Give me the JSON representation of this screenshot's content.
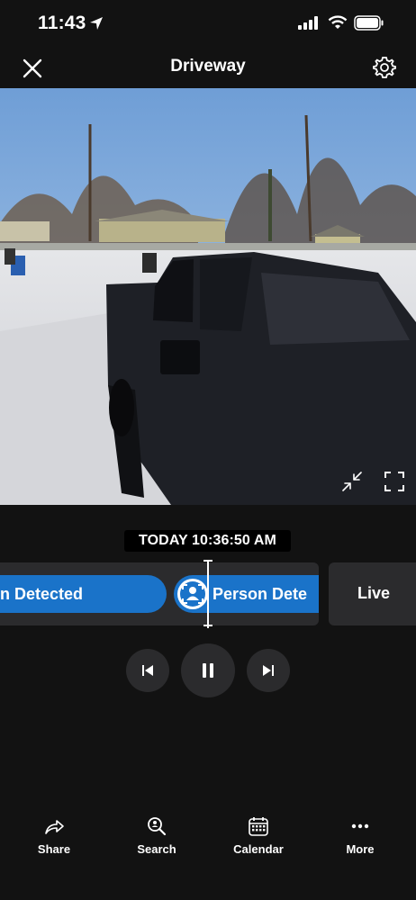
{
  "status_bar": {
    "time": "11:43"
  },
  "header": {
    "title": "Driveway"
  },
  "video": {
    "timestamp": "TODAY 10:36:50 AM"
  },
  "timeline": {
    "events": [
      {
        "label": "n Detected"
      },
      {
        "label": "Person Dete"
      }
    ],
    "live_label": "Live"
  },
  "bottom_nav": {
    "share": "Share",
    "search": "Search",
    "calendar": "Calendar",
    "more": "More"
  },
  "colors": {
    "accent": "#1a73c9",
    "background": "#121212",
    "surface": "#2b2b2d"
  },
  "icons": [
    "location-arrow-icon",
    "cellular-signal-icon",
    "wifi-icon",
    "battery-icon",
    "close-icon",
    "gear-icon",
    "minimize-icon",
    "fullscreen-icon",
    "person-icon",
    "skip-back-icon",
    "pause-icon",
    "skip-forward-icon",
    "share-icon",
    "search-icon",
    "calendar-icon",
    "more-icon"
  ]
}
